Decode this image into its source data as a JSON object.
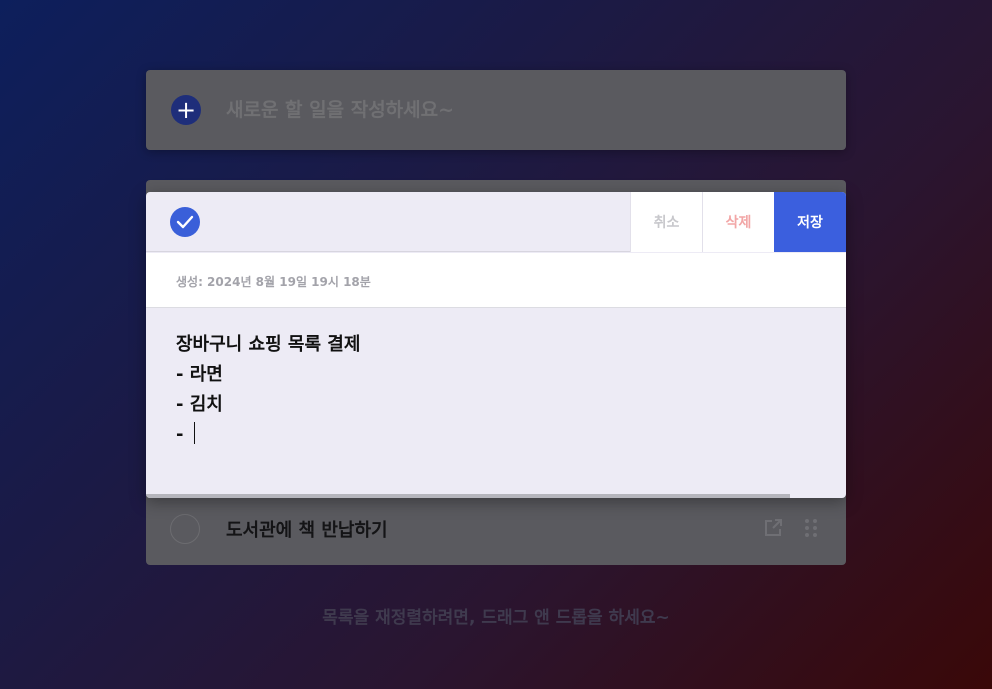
{
  "new_todo": {
    "placeholder": "새로운 할 일을 작성하세요~",
    "add_icon": "plus-icon"
  },
  "list": {
    "items": [
      {
        "text": "도서관에 책 반납하기",
        "done": false,
        "open_icon": "external-link-icon",
        "drag_icon": "drag-handle-icon"
      }
    ]
  },
  "modal": {
    "check_icon": "checkmark-icon",
    "cancel_label": "취소",
    "delete_label": "삭제",
    "save_label": "저장",
    "created": "생성: 2024년 8월 19일 19시 18분",
    "body_lines": [
      "장바구니 쇼핑 목록 결제",
      "- 라면",
      "- 김치",
      "- "
    ]
  },
  "footer": {
    "hint": "목록을 재정렬하려면, 드래그 앤 드롭을 하세요~"
  },
  "colors": {
    "accent": "#3b5fde",
    "delete": "#f2a6a6",
    "overlay_panel": "#5a5a5f"
  }
}
